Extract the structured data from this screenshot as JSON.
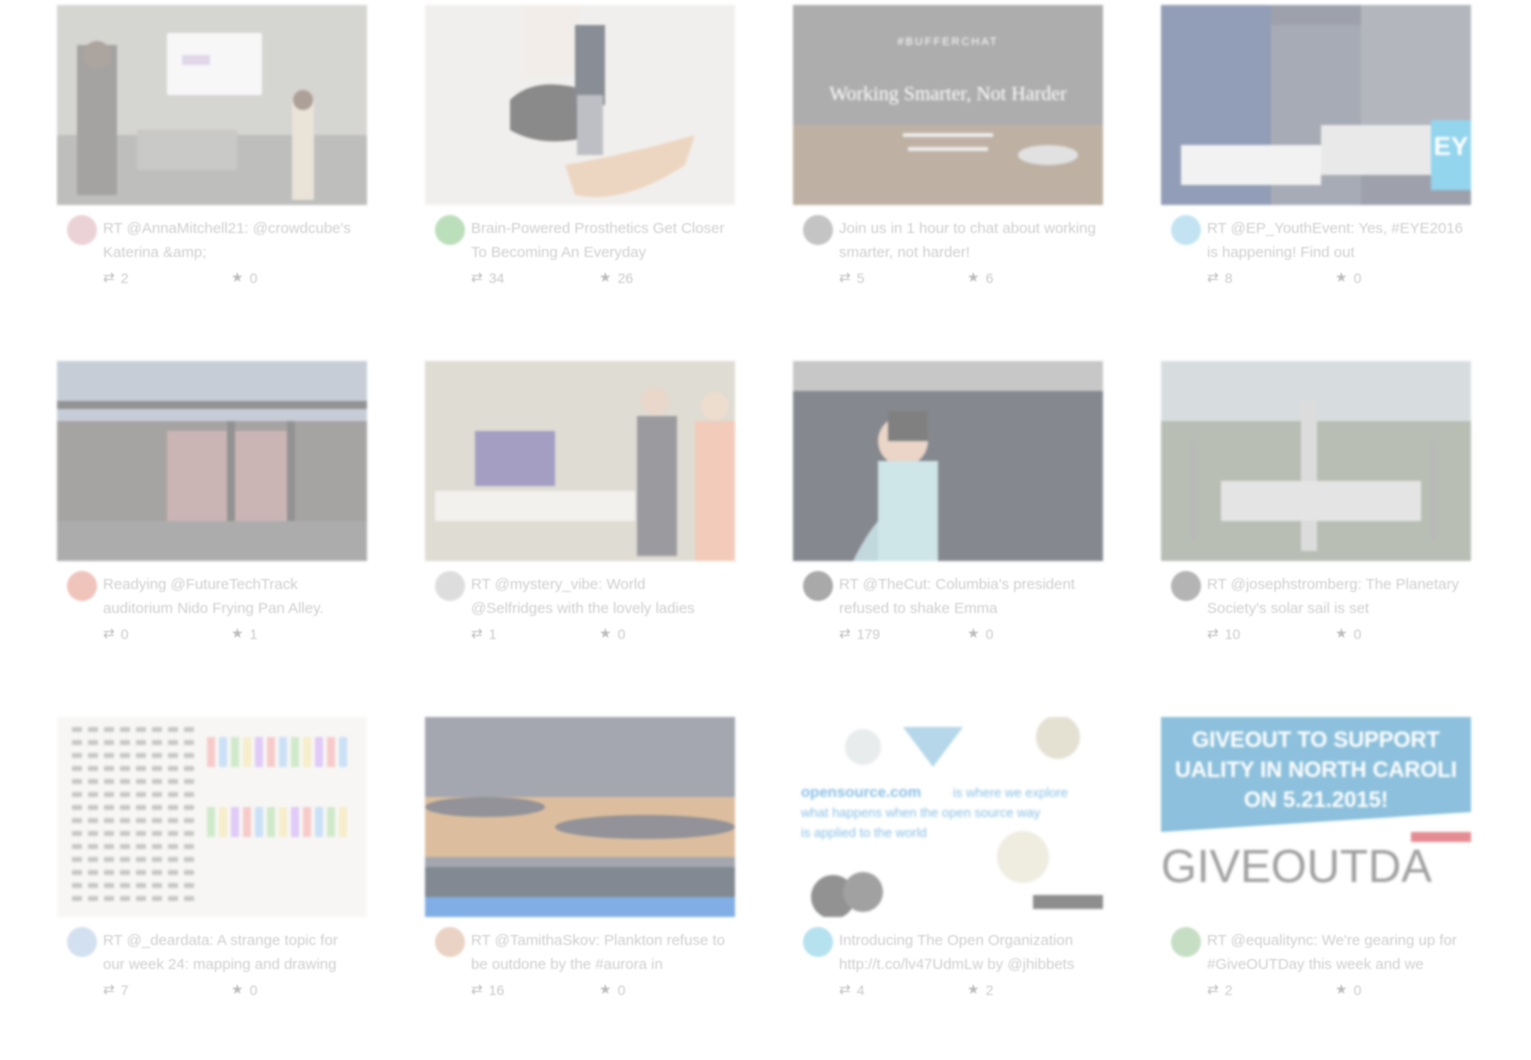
{
  "cards": [
    {
      "text": "RT @AnnaMitchell21: @crowdcube's Katerina &amp;",
      "retweets": "2",
      "favorites": "0",
      "avatar_color": "#d9a7b0",
      "image": "presentation-room"
    },
    {
      "text": "Brain-Powered Prosthetics Get Closer To Becoming An Everyday",
      "retweets": "34",
      "favorites": "26",
      "avatar_color": "#7cc07a",
      "image": "prosthetic-leg"
    },
    {
      "text": "Join us in 1 hour to chat about working smarter, not harder!",
      "retweets": "5",
      "favorites": "6",
      "avatar_color": "#8a8a8a",
      "image": "bufferchat-poster",
      "overlay_tag": "#BUFFERCHAT",
      "overlay_title": "Working Smarter, Not Harder"
    },
    {
      "text": "RT @EP_YouthEvent: Yes, #EYE2016 is happening! Find out",
      "retweets": "8",
      "favorites": "0",
      "avatar_color": "#88c9e6",
      "image": "students-writing",
      "overlay_badge": "EY"
    },
    {
      "text": "Readying @FutureTechTrack auditorium Nido Frying Pan Alley.",
      "retweets": "0",
      "favorites": "1",
      "avatar_color": "#e08a7a",
      "image": "auditorium"
    },
    {
      "text": "RT @mystery_vibe: World @Selfridges with the lovely ladies",
      "retweets": "1",
      "favorites": "0",
      "avatar_color": "#bdbdbd",
      "image": "shop-display"
    },
    {
      "text": "RT @TheCut: Columbia's president refused to shake Emma",
      "retweets": "179",
      "favorites": "0",
      "avatar_color": "#555555",
      "image": "woman-with-camera"
    },
    {
      "text": "RT @josephstromberg: The Planetary Society's solar sail is set",
      "retweets": "10",
      "favorites": "0",
      "avatar_color": "#6b6b6b",
      "image": "launch-pad"
    },
    {
      "text": "RT @_deardata: A strange topic for our week 24: mapping and drawing",
      "retweets": "7",
      "favorites": "0",
      "avatar_color": "#a9c3e0",
      "image": "data-drawing"
    },
    {
      "text": "RT @TamithaSkov: Plankton refuse to be outdone by the #aurora in",
      "retweets": "16",
      "favorites": "0",
      "avatar_color": "#d7a98a",
      "image": "glowing-sea"
    },
    {
      "text": "Introducing The Open Organization http://t.co/lv47UdmLw by @jhibbets",
      "retweets": "4",
      "favorites": "2",
      "avatar_color": "#6fc4e0",
      "image": "opensource-graphic",
      "overlay_brand": "opensource.com",
      "overlay_line1": "is where we explore",
      "overlay_line2": "what happens when the open source way",
      "overlay_line3": "is applied to the world"
    },
    {
      "text": "RT @equalitync: We're gearing up for #GiveOUTDay this week and we",
      "retweets": "2",
      "favorites": "0",
      "avatar_color": "#8fbf8a",
      "image": "giveout-banner",
      "overlay_line1": "GIVEOUT TO SUPPORT",
      "overlay_line2": "UALITY IN NORTH CAROLI",
      "overlay_line3": "ON 5.21.2015!",
      "overlay_big": "GIVEOUTDA"
    }
  ],
  "icons": {
    "retweet": "retweet-icon",
    "favorite": "star-icon"
  }
}
